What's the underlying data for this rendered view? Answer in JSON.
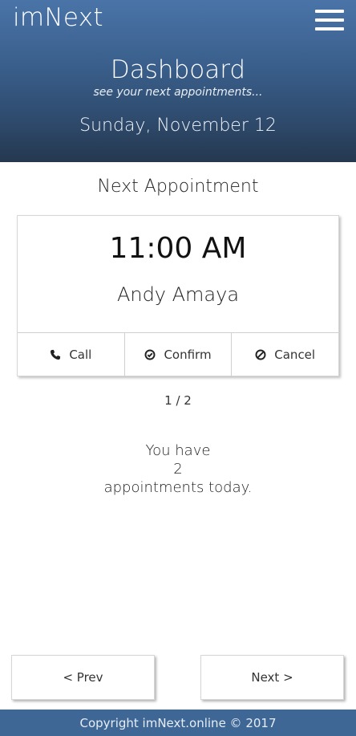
{
  "header": {
    "brand": "imNext",
    "menu_icon": "hamburger-menu-icon",
    "title": "Dashboard",
    "subtitle": "see your next appointments...",
    "date": "Sunday, November 12"
  },
  "colors": {
    "header_gradient_top": "#4a74a8",
    "header_gradient_bottom": "#25384f",
    "footer_bg": "#3f6796"
  },
  "main": {
    "section_title": "Next Appointment",
    "appointment": {
      "time": "11:00 AM",
      "name": "Andy Amaya"
    },
    "actions": [
      {
        "label": "Call",
        "icon": "phone-icon"
      },
      {
        "label": "Confirm",
        "icon": "check-circle-icon"
      },
      {
        "label": "Cancel",
        "icon": "ban-icon"
      }
    ],
    "pager": "1 / 2",
    "summary": {
      "line1": "You have",
      "count": "2",
      "line3": "appointments today."
    }
  },
  "nav": {
    "prev_label": "< Prev",
    "next_label": "Next >"
  },
  "footer": {
    "copyright": "Copyright imNext.online © 2017"
  }
}
